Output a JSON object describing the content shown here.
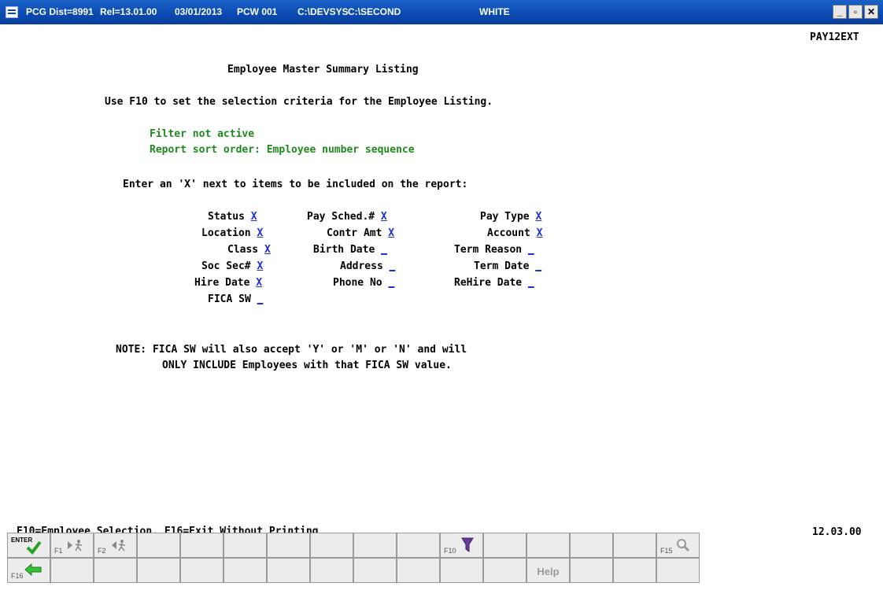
{
  "window": {
    "title_segments": [
      "PCG Dist=8991",
      "Rel=13.01.00",
      "03/01/2013",
      "PCW 001",
      "C:\\DEVSYS",
      "C:\\SECOND",
      "WHITE"
    ],
    "minimize_glyph": "_",
    "maximize_glyph": "▫",
    "close_glyph": "✕"
  },
  "screen": {
    "program_id": "PAY12EXT",
    "heading": "Employee Master Summary Listing",
    "instruction": "Use F10 to set the selection criteria for the Employee Listing.",
    "filter_status": "Filter not active",
    "sort_order": "Report sort order: Employee number sequence",
    "include_prompt": "Enter an 'X' next to items to be included on the report:",
    "fields": [
      {
        "label": "Status",
        "value": "X"
      },
      {
        "label": "Pay Sched.#",
        "value": "X"
      },
      {
        "label": "Pay Type",
        "value": "X"
      },
      {
        "label": "Location",
        "value": "X"
      },
      {
        "label": "Contr Amt",
        "value": "X"
      },
      {
        "label": "Account",
        "value": "X"
      },
      {
        "label": "Class",
        "value": "X"
      },
      {
        "label": "Birth Date",
        "value": "_"
      },
      {
        "label": "Term Reason",
        "value": "_"
      },
      {
        "label": "Soc Sec#",
        "value": "X"
      },
      {
        "label": "Address",
        "value": "_"
      },
      {
        "label": "Term Date",
        "value": "_"
      },
      {
        "label": "Hire Date",
        "value": "X"
      },
      {
        "label": "Phone No",
        "value": "_"
      },
      {
        "label": "ReHire Date",
        "value": "_"
      },
      {
        "label": "FICA SW",
        "value": "_"
      }
    ],
    "note_line1": "NOTE: FICA SW will also accept 'Y' or 'M' or 'N' and will",
    "note_line2": "ONLY INCLUDE Employees with that FICA SW value.",
    "function_keys_text": "F10=Employee Selection, F16=Exit Without Printing",
    "version": "12.03.00"
  },
  "toolbar": {
    "enter_label": "ENTER",
    "f1_label": "F1",
    "f2_label": "F2",
    "f10_label": "F10",
    "f15_label": "F15",
    "f16_label": "F16",
    "help_label": "Help",
    "icons": {
      "enter": "checkmark-icon",
      "f1": "run-forward-icon",
      "f2": "run-back-icon",
      "f10": "filter-icon",
      "f15": "magnifier-icon",
      "f16": "back-arrow-icon"
    }
  }
}
